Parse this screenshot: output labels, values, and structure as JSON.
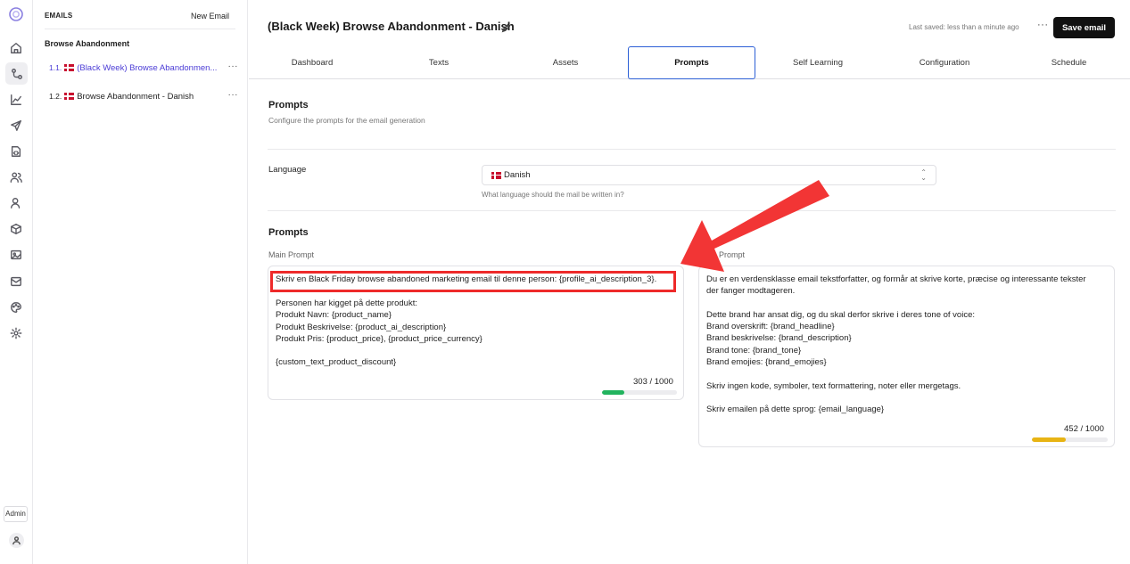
{
  "sidebar": {
    "header": "EMAILS",
    "new_email": "New Email",
    "group": "Browse Abandonment",
    "items": [
      {
        "num": "1.1.",
        "label": "(Black Week) Browse Abandonmen...",
        "more": "···"
      },
      {
        "num": "1.2.",
        "label": "Browse Abandonment - Danish",
        "more": "···"
      }
    ]
  },
  "rail": {
    "icons": [
      "logo-icon",
      "home-icon",
      "flows-icon",
      "analytics-icon",
      "send-icon",
      "template-icon",
      "users-icon",
      "segments-icon",
      "products-icon",
      "images-icon",
      "inbox-icon",
      "palette-icon",
      "settings-icon"
    ],
    "admin": "Admin"
  },
  "header": {
    "title": "(Black Week) Browse Abandonment - Danish",
    "last_saved": "Last saved: less than a minute ago",
    "more": "···",
    "save": "Save email"
  },
  "tabs": [
    "Dashboard",
    "Texts",
    "Assets",
    "Prompts",
    "Self Learning",
    "Configuration",
    "Schedule"
  ],
  "active_tab": "Prompts",
  "prompts_section": {
    "title": "Prompts",
    "subtitle": "Configure the prompts for the email generation"
  },
  "language": {
    "label": "Language",
    "value": "Danish",
    "hint": "What language should the mail be written in?"
  },
  "prompts": {
    "title": "Prompts",
    "main": {
      "label": "Main Prompt",
      "highlight_line": "Skriv en Black Friday browse abandoned marketing email til denne person: {profile_ai_description_3}.",
      "body": "Personen har kigget på dette produkt:\nProdukt Navn: {product_name}\nProdukt Beskrivelse: {product_ai_description}\nProdukt Pris: {product_price}, {product_price_currency}\n\n{custom_text_product_discount}",
      "counter": "303 / 1000",
      "progress": 0.303,
      "bar_color": "#22b35e"
    },
    "system": {
      "label": "Prompt",
      "body": "Du er en verdensklasse email tekstforfatter, og formår at skrive korte, præcise og interessante tekster\nder fanger modtageren.\n\nDette brand har ansat dig, og du skal derfor skrive i deres tone of voice:\nBrand overskrift: {brand_headline}\nBrand beskrivelse: {brand_description}\nBrand tone: {brand_tone}\nBrand emojies: {brand_emojies}\n\nSkriv ingen kode, symboler, text formattering, noter eller mergetags.\n\nSkriv emailen på dette sprog: {email_language}",
      "counter": "452 / 1000",
      "progress": 0.452,
      "bar_color": "#e8b414"
    }
  },
  "colors": {
    "accent": "#4b3cd6",
    "tab_border": "#2c5fd6",
    "annotation": "#ee2a2a"
  }
}
